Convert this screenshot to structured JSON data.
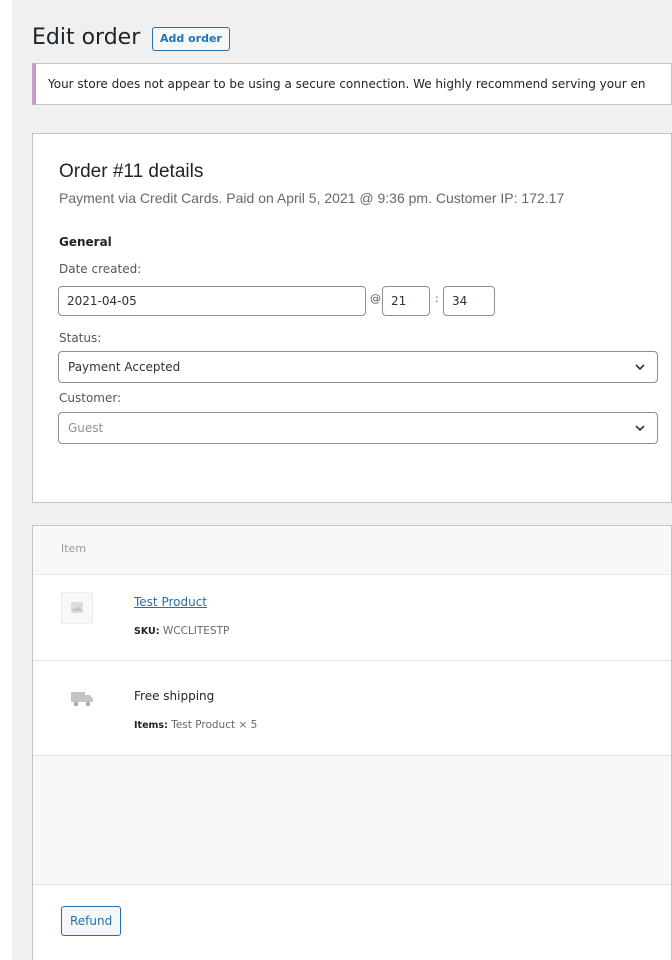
{
  "header": {
    "title": "Edit order",
    "add_order_label": "Add order"
  },
  "notice": {
    "text": "Your store does not appear to be using a secure connection. We highly recommend serving your en"
  },
  "order": {
    "heading": "Order #11 details",
    "payment_line": "Payment via Credit Cards. Paid on April 5, 2021 @ 9:36 pm. Customer IP: 172.17",
    "section_general": "General",
    "date_created_label": "Date created:",
    "date_value": "2021-04-05",
    "at_symbol": "@",
    "hour_value": "21",
    "colon": ":",
    "minute_value": "34",
    "status_label": "Status:",
    "status_value": "Payment Accepted",
    "customer_label": "Customer:",
    "customer_value": "Guest"
  },
  "items": {
    "column_item": "Item",
    "rows": [
      {
        "name": "Test Product",
        "meta_key": "SKU:",
        "meta_value": "WCCLITESTP",
        "icon": "image-placeholder-icon"
      },
      {
        "name": "Free shipping",
        "meta_key": "Items:",
        "meta_value": "Test Product × 5",
        "icon": "shipping-truck-icon"
      }
    ],
    "refund_label": "Refund"
  },
  "colors": {
    "accent": "#2271b1",
    "notice_border": "#c99ac3",
    "background": "#f0f0f1"
  }
}
